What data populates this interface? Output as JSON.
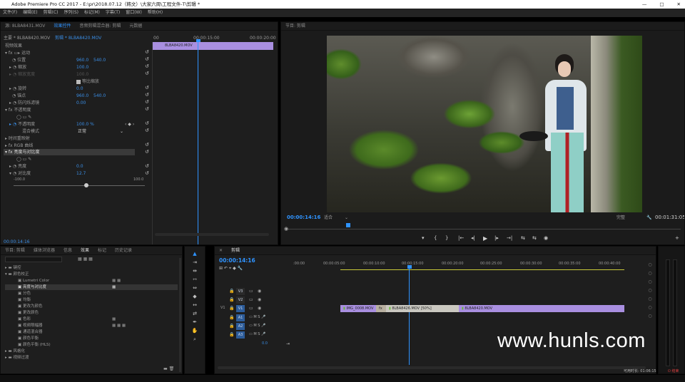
{
  "window": {
    "title": "Adobe Premiere Pro CC 2017 - E:\\pr\\2018.07.12（韩文）\\大家六周\\工程文件-T\\剪辑 *",
    "minimize": "—",
    "maximize": "□",
    "close": "✕"
  },
  "menu": [
    "文件(F)",
    "编辑(E)",
    "剪辑(C)",
    "序列(S)",
    "标记(M)",
    "字幕(T)",
    "窗口(W)",
    "帮助(H)"
  ],
  "effect_controls": {
    "tabs": [
      "源: 8LBA8431.MOV",
      "效果控件",
      "音频剪辑混合器: 剪辑",
      "元数据"
    ],
    "header_master": "主要 * 8LBA8420.MOV",
    "header_clip": "剪辑 * 8LBA8420.MOV",
    "time_start": "00",
    "time_mid": "00:00:15:00",
    "time_end": "00:00:20:00",
    "clip_bar": "8LBA8420.MOV",
    "section_video": "视频效果",
    "motion": "运动",
    "position_label": "位置",
    "position_x": "960.0",
    "position_y": "540.0",
    "scale_label": "缩放",
    "scale_value": "100.0",
    "scale_width_label": "缩放宽度",
    "scale_width_value": "100.0",
    "uniform_label": "等比缩放",
    "rotation_label": "旋转",
    "rotation_value": "0.0",
    "anchor_label": "锚点",
    "anchor_x": "960.0",
    "anchor_y": "540.0",
    "antiflicker_label": "防闪烁滤镜",
    "antiflicker_value": "0.00",
    "opacity": "不透明度",
    "opacity_label": "不透明度",
    "opacity_value": "100.0 %",
    "blend_label": "混合模式",
    "blend_value": "正常",
    "time_remap": "时间重映射",
    "rgb_curves": "RGB 曲线",
    "brightness_contrast": "亮度与对比度",
    "brightness_label": "亮度",
    "brightness_value": "0.0",
    "contrast_label": "对比度",
    "contrast_value": "12.7",
    "slider_min": "-100.0",
    "slider_max": "100.0",
    "timecode": "00:00:14:16"
  },
  "program": {
    "title": "节目: 剪辑",
    "timecode": "00:00:14:16",
    "fit": "适合",
    "quality": "完整",
    "duration": "00:01:31:05",
    "controls": [
      "▾",
      "{",
      "}",
      "|←",
      "◂|",
      "▶",
      "|▸",
      "→|",
      "⇆",
      "⇆",
      "◉"
    ]
  },
  "effects_panel": {
    "tabs": [
      "节目: 剪辑",
      "媒体浏览器",
      "信息",
      "效果",
      "标记",
      "历史记录"
    ],
    "items": [
      "键控",
      "颜色校正",
      "Lumetri Color",
      "亮度与对比度",
      "分色",
      "均衡",
      "更改为颜色",
      "更改颜色",
      "色彩",
      "视频限幅器",
      "通道混合器",
      "颜色平衡",
      "颜色平衡 (HLS)",
      "风格化",
      "视频过渡"
    ]
  },
  "timeline": {
    "tab": "剪辑",
    "timecode": "00:00:14:16",
    "ruler": [
      ":00:00",
      "00:00:05:00",
      "00:00:10:00",
      "00:00:15:00",
      "00:00:20:00",
      "00:00:25:00",
      "00:00:30:00",
      "00:00:35:00",
      "00:00:40:00"
    ],
    "video_tracks": [
      "V3",
      "V2",
      "V1"
    ],
    "audio_tracks": [
      "A1",
      "A2",
      "A3"
    ],
    "v1_label": "V1",
    "clips": [
      "IMG_0008.MOV",
      "fx",
      "8LBA8426.MOV [50%]",
      "8LBA8420.MOV"
    ],
    "master_value": "0.0",
    "status": "可用时长: 01:06:15",
    "status_btn": "结束"
  },
  "watermark": "www.hunls.com",
  "colors": {
    "accent": "#2f93ff",
    "clip": "#a98fe0",
    "clip_dark": "#8e74cc",
    "panel": "#1e1e1e"
  }
}
